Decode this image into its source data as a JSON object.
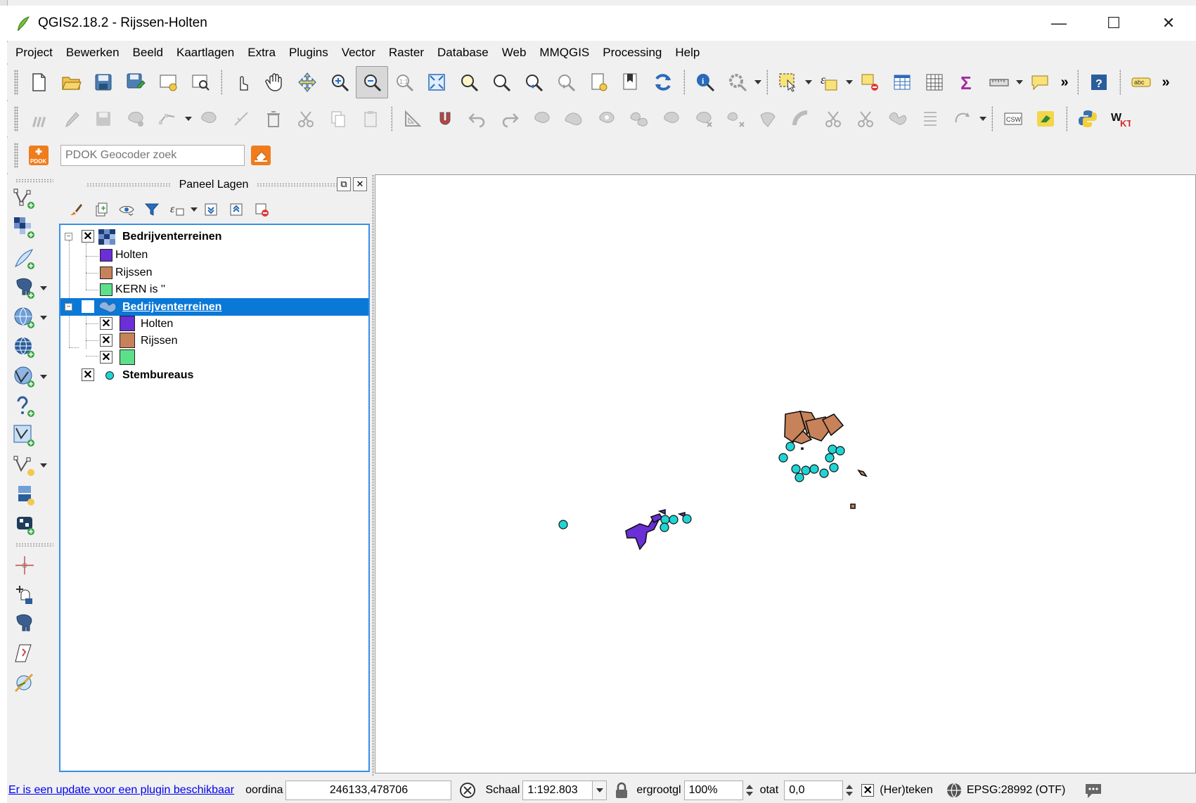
{
  "window": {
    "title": "QGIS2.18.2 - Rijssen-Holten",
    "minimize": "—",
    "maximize": "☐",
    "close": "✕"
  },
  "menu": [
    "Project",
    "Bewerken",
    "Beeld",
    "Kaartlagen",
    "Extra",
    "Plugins",
    "Vector",
    "Raster",
    "Database",
    "Web",
    "MMQGIS",
    "Processing",
    "Help"
  ],
  "toolbar_more": "»",
  "pdok": {
    "button_label": "PDOK",
    "placeholder": "PDOK Geocoder zoek"
  },
  "panel": {
    "title": "Paneel Lagen",
    "float_btn": "⧉",
    "close_btn": "✕"
  },
  "layers": {
    "group1": {
      "name": "Bedrijventerreinen",
      "checked": "✕",
      "expander": "−",
      "classes": [
        {
          "label": "Holten",
          "color": "#6a2fd6"
        },
        {
          "label": "Rijssen",
          "color": "#c8825a"
        },
        {
          "label": "KERN is ''",
          "color": "#5ee08a"
        }
      ]
    },
    "group2": {
      "name": "Bedrijventerreinen",
      "expander": "−",
      "classes": [
        {
          "label": "Holten",
          "color": "#6a2fd6",
          "checked": "✕"
        },
        {
          "label": "Rijssen",
          "color": "#c8825a",
          "checked": "✕"
        },
        {
          "label": "",
          "color": "#5ee08a",
          "checked": "✕"
        }
      ]
    },
    "stembureaus": {
      "name": "Stembureaus",
      "checked": "✕",
      "color": "#1fd4d4"
    }
  },
  "status": {
    "update_link": "Er is een update voor een plugin beschikbaar",
    "coord_label": "oordina",
    "coord_value": "246133,478706",
    "scale_label": "Schaal",
    "scale_value": "1:192.803",
    "magnifier_label": "ergrootgl",
    "magnifier_value": "100%",
    "rotation_label": "otat",
    "rotation_value": "0,0",
    "render_checked": "✕",
    "render_label": "(Her)teken",
    "crs": "EPSG:28992 (OTF)"
  },
  "colors": {
    "holten": "#6a2fd6",
    "rijssen": "#c8825a",
    "kern_empty": "#5ee08a",
    "stembureau": "#1fd4d4",
    "selection": "#0a78d7"
  }
}
